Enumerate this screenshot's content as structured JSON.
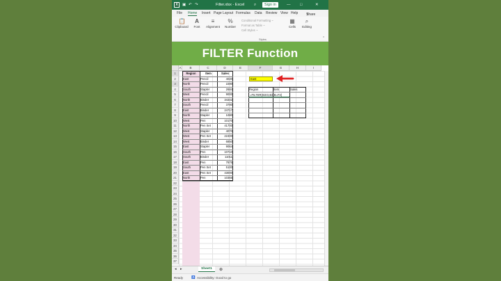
{
  "titlebar": {
    "file_title": "Filter.xlsx - Excel",
    "sign_in": "Sign in",
    "search_icon": "search-icon",
    "minimize": "—",
    "maximize": "□",
    "close": "✕"
  },
  "menu": {
    "tabs": [
      "File",
      "Home",
      "Insert",
      "Page Layout",
      "Formulas",
      "Data",
      "Review",
      "View",
      "Help"
    ],
    "share": "Share"
  },
  "ribbon": {
    "groups": [
      {
        "label": "Clipboard",
        "icon": "clipboard-icon"
      },
      {
        "label": "Font",
        "icon": "font-icon"
      },
      {
        "label": "Alignment",
        "icon": "alignment-icon"
      },
      {
        "label": "Number",
        "icon": "percent-icon"
      },
      {
        "label": "Cells",
        "icon": "cells-icon"
      },
      {
        "label": "Editing",
        "icon": "editing-icon"
      }
    ],
    "styles": [
      "Conditional Formatting ~",
      "Format as Table ~",
      "Cell Styles ~"
    ],
    "styles_label": "Styles"
  },
  "banner": {
    "title": "FILTER Function"
  },
  "columns": [
    "A",
    "B",
    "C",
    "D",
    "E",
    "F",
    "G",
    "H",
    "I"
  ],
  "table": {
    "headers": [
      "Region",
      "Item",
      "Sales"
    ],
    "rows": [
      [
        "East",
        "Pencil",
        "4020"
      ],
      [
        "North",
        "Pencil",
        "2280"
      ],
      [
        "South",
        "Stapler",
        "2684"
      ],
      [
        "West",
        "Pencil",
        "9000"
      ],
      [
        "North",
        "Binder",
        "34342"
      ],
      [
        "South",
        "Pencil",
        "3780"
      ],
      [
        "East",
        "Binder",
        "24717"
      ],
      [
        "North",
        "Stapler",
        "1080"
      ],
      [
        "West",
        "Pen",
        "10170"
      ],
      [
        "North",
        "Pen Set",
        "41700"
      ],
      [
        "West",
        "Stapler",
        "4070"
      ],
      [
        "West",
        "Pen Set",
        "22400"
      ],
      [
        "West",
        "Binder",
        "6850"
      ],
      [
        "East",
        "Stapler",
        "9064"
      ],
      [
        "South",
        "Pen",
        "10710"
      ],
      [
        "South",
        "Binder",
        "11011"
      ],
      [
        "East",
        "Pen",
        "7875"
      ],
      [
        "South",
        "Pen Set",
        "5100"
      ],
      [
        "East",
        "Pen Set",
        "43000"
      ],
      [
        "North",
        "Pen",
        "10365"
      ]
    ]
  },
  "criteria": {
    "value": "East"
  },
  "result": {
    "headers": [
      "Region",
      "Item",
      "Sales"
    ],
    "formula": "=FILTER(B3:D,B3:B=F2)"
  },
  "sheet": {
    "tab": "Sheet1"
  },
  "status": {
    "ready": "Ready",
    "accessibility": "Accessibility: Good to go"
  },
  "colors": {
    "excel_green": "#217346",
    "banner": "#70ad47",
    "highlight": "#ffff00",
    "arrow": "#e02020",
    "column_fill": "#f3dce8"
  }
}
